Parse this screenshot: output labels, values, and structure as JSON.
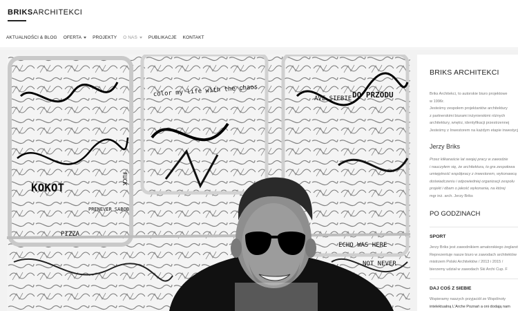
{
  "site": {
    "logo_bold": "BRIKS",
    "logo_light": "ARCHITEKCI"
  },
  "nav": {
    "items": [
      {
        "label": "AKTUALNOŚCI & BLOG",
        "has_dropdown": false
      },
      {
        "label": "OFERTA",
        "has_dropdown": true
      },
      {
        "label": "PROJEKTY",
        "has_dropdown": false
      },
      {
        "label": "O NAS",
        "has_dropdown": true
      },
      {
        "label": "PUBLIKACJE",
        "has_dropdown": false
      },
      {
        "label": "KONTAKT",
        "has_dropdown": false
      }
    ]
  },
  "sidebar": {
    "title": "BRIKS ARCHITEKCI",
    "intro": [
      "Briks Architekci, to autorskie biuro projektowe",
      "w 1996r.",
      "Jesteśmy zespołem projektantów architektury",
      "z partnerskimi biurami inżynierskimi różnych",
      "architektury, wnętrz, identyfikacji przestrzennej",
      "Jesteśmy z Inwestorem na każdym etapie inwestycji"
    ],
    "person_name": "Jerzy Briks",
    "quote": [
      "Przez kilkanaście lat swojej pracy w zawodzie",
      "i nauczyłem się, że architektura, to gra zespołowa",
      "umiejętność współpracy z inwestorem, wykonawcą",
      "doświadczeniu i odpowiedniej organizacji zespołu",
      "projekt i dbam o jakość wykonania, na której",
      "mgr inż. arch. Jerzy Briks"
    ],
    "section2_title": "PO GODZINACH",
    "sport_title": "SPORT",
    "sport_text": [
      "Jerzy Briks jest zawodnikiem amatorskiego żeglarstwa",
      "Reprezentuje nasze biuro w zawodach architektów",
      "mistrzem Polski Architektów / 2013 i 2015 /",
      "bierzemy udział w zawodach Ski Archi Cup. F"
    ],
    "give_title": "DAJ COŚ Z SIEBIE",
    "give_text": [
      "Wspieramy naszych przyjaciół ze Wspólnoty",
      "intelektualną L'Arche Poznań a oni dodają nam"
    ]
  },
  "photo": {
    "graffiti_text": [
      "color my life with the chaos",
      "AVE SIEBIE",
      "DO PRZODU",
      "ECHO WAS HERE",
      "PIZZA",
      "KOKOT",
      "NOT NEVER",
      "PRENEVER SABOB",
      "FUCK"
    ]
  }
}
